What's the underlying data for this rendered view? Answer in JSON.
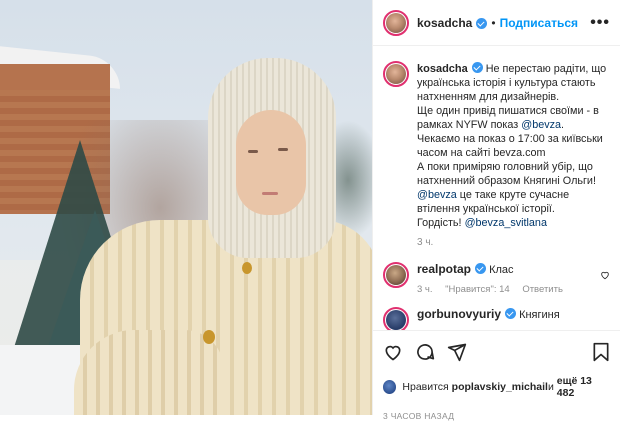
{
  "post": {
    "username": "kosadcha",
    "follow_label": "Подписаться",
    "dot": "•",
    "more_label": "•••"
  },
  "caption": {
    "username": "kosadcha",
    "text_1": " Не перестаю радіти, що українська історія і культура стають натхненням для дизайнерів.\nЩе один привід пишатися своїми - в рамках NYFW показ ",
    "mention_1": "@bevza",
    "text_2": ".\nЧекаємо на показ о 17:00 за київськи часом на сайті bevza.com\nА поки приміряю головний убір, що натхненний образом Княгині Ольги! ",
    "mention_2": "@bevza",
    "text_3": " це таке круте сучасне втілення української історії.\nГордість! ",
    "mention_3": "@bevza_svitlana",
    "time": "3 ч."
  },
  "comments": [
    {
      "username": "realpotap",
      "text": "Клас",
      "time": "3 ч.",
      "likes": "\"Нравится\": 14",
      "reply": "Ответить"
    },
    {
      "username": "gorbunovyuriy",
      "text": "Княгиня"
    }
  ],
  "likes": {
    "prefix": "Нравится ",
    "user": "poplavskiy_michail",
    "middle": " и ",
    "count": "ещё 13 482"
  },
  "timestamp": "3 ЧАСОВ НАЗАД",
  "colors": {
    "accent": "#0095f6",
    "verified": "#3897f0",
    "ring": "#e0306f"
  },
  "icons": [
    "heart-icon",
    "comment-icon",
    "share-icon",
    "bookmark-icon",
    "verified-icon",
    "more-icon"
  ]
}
